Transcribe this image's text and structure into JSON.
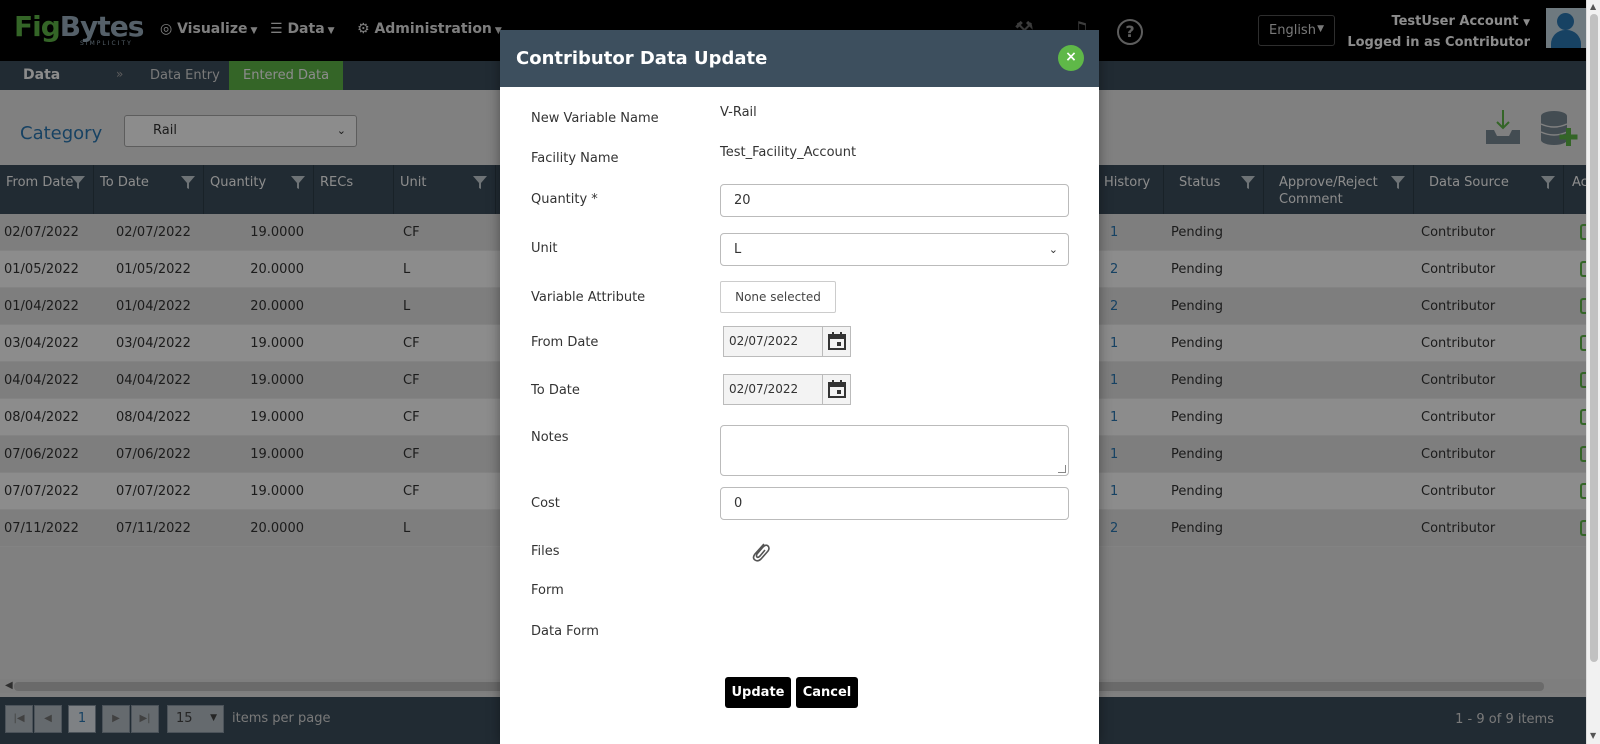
{
  "nav": {
    "logo_fig": "Fig",
    "logo_bytes": "Bytes",
    "logo_sub": "SIMPLICITY",
    "menu": [
      {
        "label": "Visualize",
        "icon": "visualize-icon"
      },
      {
        "label": "Data",
        "icon": "database-icon"
      },
      {
        "label": "Administration",
        "icon": "gear-icon"
      }
    ],
    "language": "English",
    "user_name": "TestUser Account",
    "user_role": "Logged in as Contributor"
  },
  "subnav": {
    "title": "Data",
    "separator": "»",
    "tabs": [
      {
        "label": "Data Entry",
        "active": false
      },
      {
        "label": "Entered Data",
        "active": true
      }
    ]
  },
  "category": {
    "label": "Category",
    "selected": "Rail"
  },
  "grid": {
    "columns": [
      "From Date",
      "To Date",
      "Quantity",
      "RECs",
      "Unit",
      "History",
      "Status",
      "Approve/Reject Comment",
      "Data Source",
      "Ac"
    ],
    "rows": [
      {
        "from": "02/07/2022",
        "to": "02/07/2022",
        "qty": "19.0000",
        "unit": "CF",
        "history": "1",
        "status": "Pending",
        "source": "Contributor"
      },
      {
        "from": "01/05/2022",
        "to": "01/05/2022",
        "qty": "20.0000",
        "unit": "L",
        "history": "2",
        "status": "Pending",
        "source": "Contributor"
      },
      {
        "from": "01/04/2022",
        "to": "01/04/2022",
        "qty": "20.0000",
        "unit": "L",
        "history": "2",
        "status": "Pending",
        "source": "Contributor"
      },
      {
        "from": "03/04/2022",
        "to": "03/04/2022",
        "qty": "19.0000",
        "unit": "CF",
        "history": "1",
        "status": "Pending",
        "source": "Contributor"
      },
      {
        "from": "04/04/2022",
        "to": "04/04/2022",
        "qty": "19.0000",
        "unit": "CF",
        "history": "1",
        "status": "Pending",
        "source": "Contributor"
      },
      {
        "from": "08/04/2022",
        "to": "08/04/2022",
        "qty": "19.0000",
        "unit": "CF",
        "history": "1",
        "status": "Pending",
        "source": "Contributor"
      },
      {
        "from": "07/06/2022",
        "to": "07/06/2022",
        "qty": "19.0000",
        "unit": "CF",
        "history": "1",
        "status": "Pending",
        "source": "Contributor"
      },
      {
        "from": "07/07/2022",
        "to": "07/07/2022",
        "qty": "19.0000",
        "unit": "CF",
        "history": "1",
        "status": "Pending",
        "source": "Contributor"
      },
      {
        "from": "07/11/2022",
        "to": "07/11/2022",
        "qty": "20.0000",
        "unit": "L",
        "history": "2",
        "status": "Pending",
        "source": "Contributor"
      }
    ]
  },
  "pager": {
    "current_page": "1",
    "per_page": "15",
    "per_page_label": "items per page",
    "count_text": "1 - 9 of 9 items"
  },
  "modal": {
    "title": "Contributor Data Update",
    "close": "×",
    "labels": {
      "variable": "New Variable Name",
      "facility": "Facility Name",
      "quantity": "Quantity *",
      "unit": "Unit",
      "attribute": "Variable Attribute",
      "from": "From Date",
      "to": "To Date",
      "notes": "Notes",
      "cost": "Cost",
      "files": "Files",
      "form": "Form",
      "data_form": "Data Form"
    },
    "values": {
      "variable": "V-Rail",
      "facility": "Test_Facility_Account",
      "quantity": "20",
      "unit": "L",
      "attribute": "None selected",
      "from": "02/07/2022",
      "to": "02/07/2022",
      "notes": "",
      "cost": "0"
    },
    "buttons": {
      "update": "Update",
      "cancel": "Cancel"
    }
  },
  "colors": {
    "accent_green": "#5fb848",
    "header_slate": "#3d4f5e",
    "link_blue": "#2a78b5"
  }
}
